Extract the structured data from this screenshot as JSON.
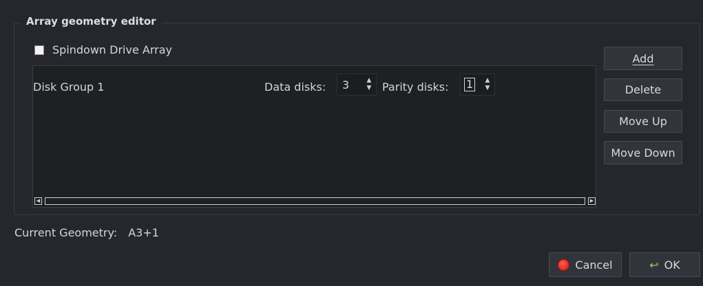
{
  "group": {
    "title": "Array geometry editor"
  },
  "spindown": {
    "label": "Spindown Drive Array",
    "checked": false
  },
  "disk_groups": [
    {
      "label": "Disk Group 1",
      "data_disks_label": "Data disks:",
      "data_disks": "3",
      "parity_disks_label": "Parity disks:",
      "parity_disks": "1"
    }
  ],
  "buttons": {
    "add": "Add",
    "delete": "Delete",
    "move_up": "Move Up",
    "move_down": "Move Down"
  },
  "status": {
    "label": "Current Geometry:",
    "value": "A3+1"
  },
  "dialog": {
    "cancel": "Cancel",
    "ok": "OK"
  },
  "icons": {
    "cancel": "red-circle-icon",
    "ok": "check-arrow-icon"
  },
  "colors": {
    "background": "#25272c",
    "list_background": "#1e2024",
    "cancel_icon": "#e0261b",
    "ok_icon": "#9bcf5c"
  }
}
